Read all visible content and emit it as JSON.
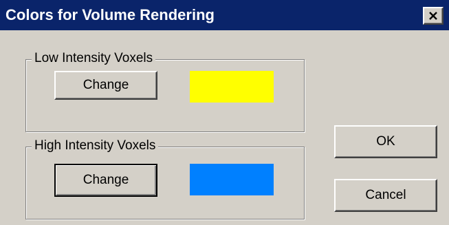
{
  "window": {
    "title": "Colors for Volume Rendering"
  },
  "low_group": {
    "label": "Low Intensity Voxels",
    "change_label": "Change",
    "swatch_color": "#ffff00"
  },
  "high_group": {
    "label": "High Intensity Voxels",
    "change_label": "Change",
    "swatch_color": "#0080ff"
  },
  "buttons": {
    "ok_label": "OK",
    "cancel_label": "Cancel"
  },
  "icons": {
    "close": "close-icon"
  }
}
